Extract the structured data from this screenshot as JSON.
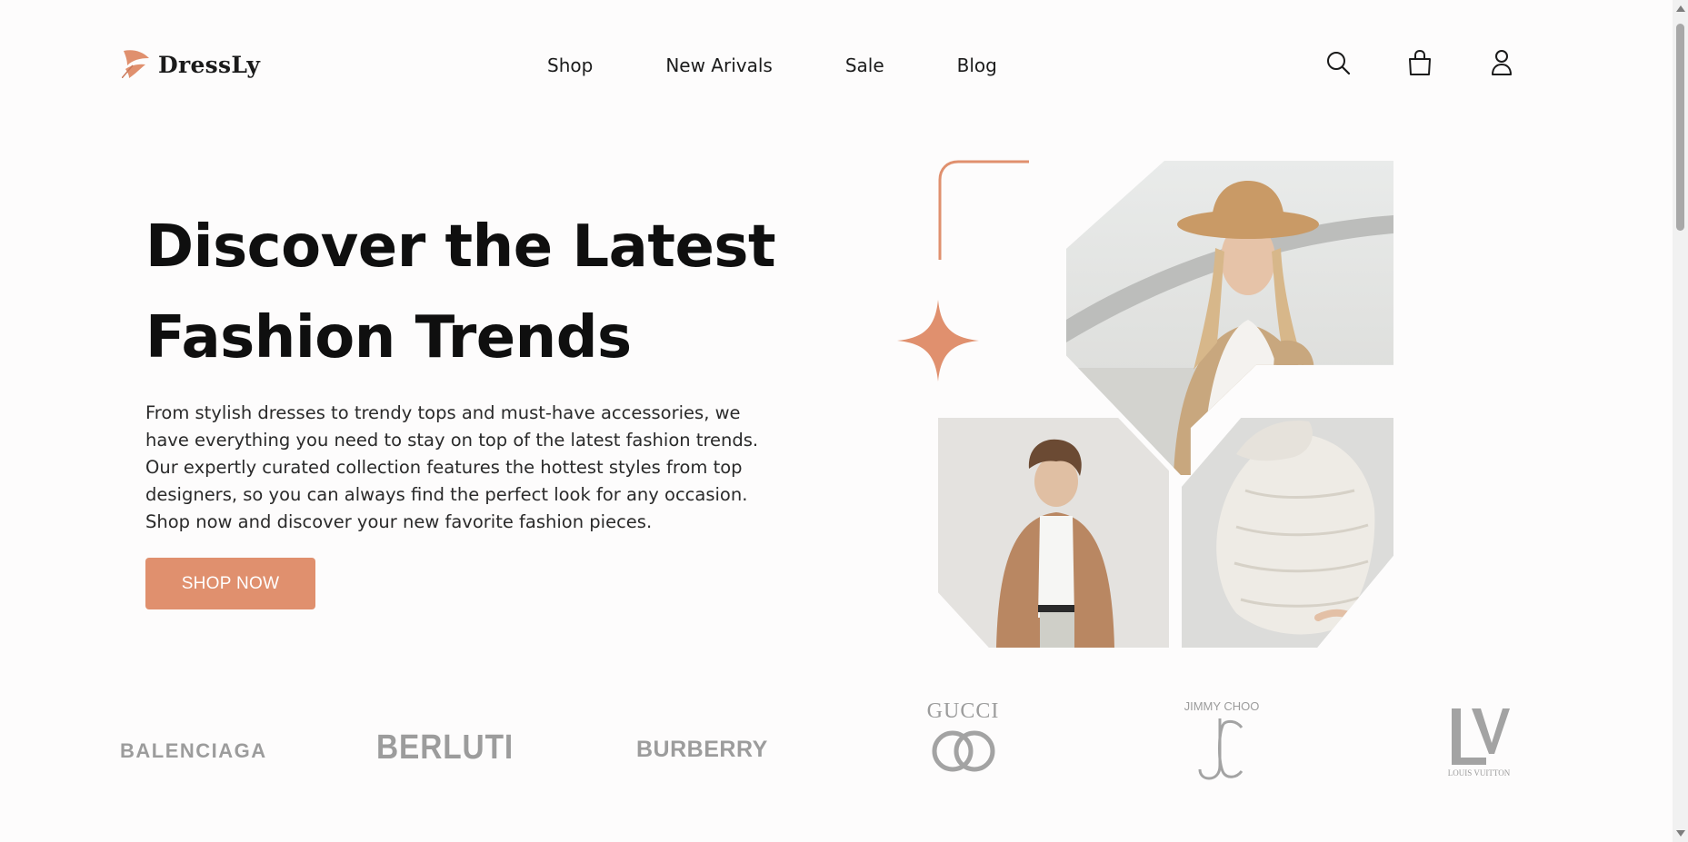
{
  "brand": {
    "name": "DressLy",
    "icon": "leaf-plane-logo-icon",
    "accent_color": "#e0906e"
  },
  "nav": {
    "items": [
      {
        "label": "Shop"
      },
      {
        "label": "New Arivals"
      },
      {
        "label": "Sale"
      },
      {
        "label": "Blog"
      }
    ]
  },
  "header_icons": {
    "search": "search-icon",
    "cart": "shopping-bag-icon",
    "account": "user-icon"
  },
  "hero": {
    "title_line1": "Discover the Latest",
    "title_line2": "Fashion Trends",
    "description": "From stylish dresses to trendy tops and must-have accessories, we have everything you need to stay on top of the latest fashion trends. Our expertly curated collection features the hottest styles from top designers, so you can always find the perfect look for any occasion. Shop now and discover your new favorite fashion pieces.",
    "cta_label": "SHOP NOW"
  },
  "brands": {
    "balenciaga": "BALENCIAGA",
    "berluti": "BERLUTI",
    "burberry": "BURBERRY",
    "gucci": "GUCCI",
    "jimmy_choo": "JIMMY CHOO",
    "louis_vuitton": "LOUIS VUITTON"
  }
}
